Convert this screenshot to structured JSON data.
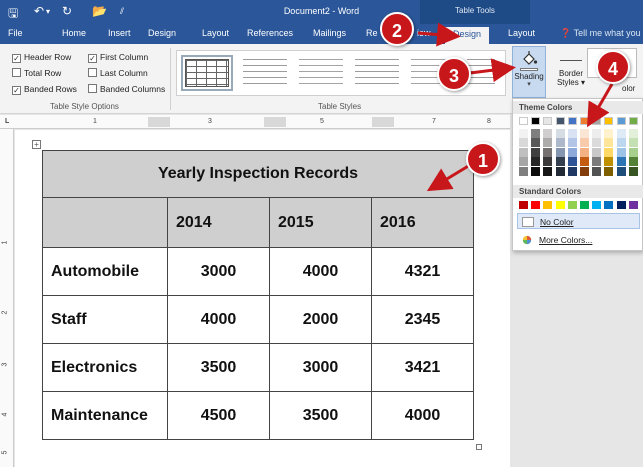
{
  "window": {
    "title": "Document2 - Word",
    "contextual_group": "Table Tools"
  },
  "tabs": [
    {
      "label": "File"
    },
    {
      "label": "Home"
    },
    {
      "label": "Insert"
    },
    {
      "label": "Design"
    },
    {
      "label": "Layout"
    },
    {
      "label": "References"
    },
    {
      "label": "Mailings"
    },
    {
      "label": "Re"
    },
    {
      "label": "iew"
    },
    {
      "label": "Design"
    },
    {
      "label": "Layout"
    }
  ],
  "tell_me": "Tell me what you w",
  "table_style_options": {
    "group_label": "Table Style Options",
    "options": [
      {
        "label": "Header Row",
        "checked": true
      },
      {
        "label": "First Column",
        "checked": true
      },
      {
        "label": "Total Row",
        "checked": false
      },
      {
        "label": "Last Column",
        "checked": false
      },
      {
        "label": "Banded Rows",
        "checked": true
      },
      {
        "label": "Banded Columns",
        "checked": false
      }
    ]
  },
  "table_styles": {
    "group_label": "Table Styles"
  },
  "shading": {
    "label": "Shading",
    "arrow": "▾"
  },
  "border_styles": {
    "label_line1": "Border",
    "label_line2": "Styles",
    "arrow": "▾"
  },
  "pen_color_fragment": "olor",
  "ruler": {
    "h_ticks": [
      "1",
      "2",
      "3",
      "4",
      "5",
      "6",
      "7",
      "8"
    ],
    "v_ticks": [
      "1",
      "2",
      "3",
      "4",
      "5"
    ]
  },
  "color_menu": {
    "theme_heading": "Theme Colors",
    "standard_heading": "Standard Colors",
    "no_color": "No Color",
    "more_colors": "More Colors...",
    "theme_colors": [
      {
        "base": "#ffffff",
        "shades": [
          "#f2f2f2",
          "#d9d9d9",
          "#bfbfbf",
          "#a6a6a6",
          "#7f7f7f"
        ]
      },
      {
        "base": "#000000",
        "shades": [
          "#7f7f7f",
          "#595959",
          "#404040",
          "#262626",
          "#0d0d0d"
        ]
      },
      {
        "base": "#e7e6e6",
        "shades": [
          "#d0cece",
          "#aeabab",
          "#757171",
          "#3a3838",
          "#171616"
        ]
      },
      {
        "base": "#44546a",
        "shades": [
          "#d6dce4",
          "#adb9ca",
          "#8496b0",
          "#333f4f",
          "#222a35"
        ]
      },
      {
        "base": "#4472c4",
        "shades": [
          "#d9e2f3",
          "#b4c6e7",
          "#8eaadb",
          "#2f5496",
          "#1f3864"
        ]
      },
      {
        "base": "#ed7d31",
        "shades": [
          "#fbe5d5",
          "#f7cbac",
          "#f4b183",
          "#c55a11",
          "#833c0b"
        ]
      },
      {
        "base": "#a5a5a5",
        "shades": [
          "#ededed",
          "#dbdbdb",
          "#c9c9c9",
          "#7b7b7b",
          "#525252"
        ]
      },
      {
        "base": "#ffc000",
        "shades": [
          "#fff2cc",
          "#fee599",
          "#ffd965",
          "#bf9000",
          "#7f6000"
        ]
      },
      {
        "base": "#5b9bd5",
        "shades": [
          "#deebf6",
          "#bdd7ee",
          "#9dc3e6",
          "#2e75b5",
          "#1e4e79"
        ]
      },
      {
        "base": "#70ad47",
        "shades": [
          "#e2efd9",
          "#c5e0b3",
          "#a8d08d",
          "#538135",
          "#375623"
        ]
      }
    ],
    "standard_colors": [
      "#c00000",
      "#ff0000",
      "#ffc000",
      "#ffff00",
      "#92d050",
      "#00b050",
      "#00b0f0",
      "#0070c0",
      "#002060",
      "#7030a0"
    ]
  },
  "document_table": {
    "title": "Yearly Inspection Records",
    "years": [
      "2014",
      "2015",
      "2016"
    ],
    "rows": [
      {
        "label": "Automobile",
        "values": [
          "3000",
          "4000",
          "4321"
        ]
      },
      {
        "label": "Staff",
        "values": [
          "4000",
          "2000",
          "2345"
        ]
      },
      {
        "label": "Electronics",
        "values": [
          "3500",
          "3000",
          "3421"
        ]
      },
      {
        "label": "Maintenance",
        "values": [
          "4500",
          "3500",
          "4000"
        ]
      }
    ]
  },
  "callouts": [
    "1",
    "2",
    "3",
    "4"
  ],
  "colors": {
    "ribbon_blue": "#2b579a",
    "header_shade": "#cfcfcf",
    "callout_red": "#c8171b"
  }
}
